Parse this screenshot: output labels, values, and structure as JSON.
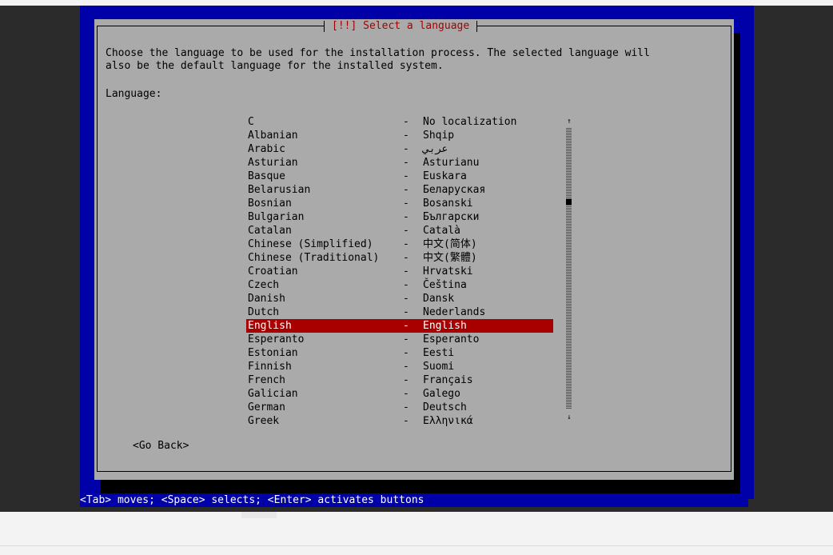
{
  "dialog": {
    "title": "[!!] Select a language",
    "instruction": "Choose the language to be used for the installation process. The selected language will\nalso be the default language for the installed system.",
    "language_label": "Language:",
    "languages": [
      {
        "name": "C",
        "dash": "-",
        "native": "No localization"
      },
      {
        "name": "Albanian",
        "dash": "-",
        "native": "Shqip"
      },
      {
        "name": "Arabic",
        "dash": "-",
        "native": "عربي"
      },
      {
        "name": "Asturian",
        "dash": "-",
        "native": "Asturianu"
      },
      {
        "name": "Basque",
        "dash": "-",
        "native": "Euskara"
      },
      {
        "name": "Belarusian",
        "dash": "-",
        "native": "Беларуская"
      },
      {
        "name": "Bosnian",
        "dash": "-",
        "native": "Bosanski"
      },
      {
        "name": "Bulgarian",
        "dash": "-",
        "native": "Български"
      },
      {
        "name": "Catalan",
        "dash": "-",
        "native": "Català"
      },
      {
        "name": "Chinese (Simplified)",
        "dash": "-",
        "native": "中文(简体)"
      },
      {
        "name": "Chinese (Traditional)",
        "dash": "-",
        "native": "中文(繁體)"
      },
      {
        "name": "Croatian",
        "dash": "-",
        "native": "Hrvatski"
      },
      {
        "name": "Czech",
        "dash": "-",
        "native": "Čeština"
      },
      {
        "name": "Danish",
        "dash": "-",
        "native": "Dansk"
      },
      {
        "name": "Dutch",
        "dash": "-",
        "native": "Nederlands"
      },
      {
        "name": "English",
        "dash": "-",
        "native": "English"
      },
      {
        "name": "Esperanto",
        "dash": "-",
        "native": "Esperanto"
      },
      {
        "name": "Estonian",
        "dash": "-",
        "native": "Eesti"
      },
      {
        "name": "Finnish",
        "dash": "-",
        "native": "Suomi"
      },
      {
        "name": "French",
        "dash": "-",
        "native": "Français"
      },
      {
        "name": "Galician",
        "dash": "-",
        "native": "Galego"
      },
      {
        "name": "German",
        "dash": "-",
        "native": "Deutsch"
      },
      {
        "name": "Greek",
        "dash": "-",
        "native": "Ελληνικά"
      }
    ],
    "selected_language": "English",
    "scroll_up": "↑",
    "scroll_down": "↓",
    "go_back_label": "<Go Back>"
  },
  "status_bar": {
    "text": "<Tab> moves; <Space> selects; <Enter> activates buttons"
  },
  "colors": {
    "console_blue": "#0000a8",
    "dialog_gray": "#aaaaaa",
    "selection_red": "#a80000",
    "title_red": "#a80000"
  }
}
